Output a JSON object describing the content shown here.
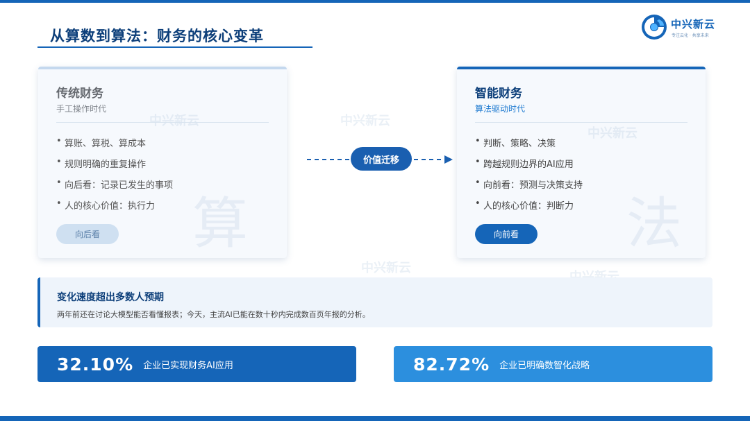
{
  "header": {
    "title": "从算数到算法：财务的核心变革",
    "logo_name": "中兴新云",
    "logo_slogan": "专注云化 · 共享未来",
    "logo_color": "#1565b8"
  },
  "traditional": {
    "title": "传统财务",
    "subtitle": "手工操作时代",
    "items": [
      "算账、算税、算成本",
      "规则明确的重复操作",
      "向后看：记录已发生的事项",
      "人的核心价值：执行力"
    ],
    "button": "向后看",
    "watermark": "算"
  },
  "transition": {
    "label": "价值迁移"
  },
  "intelligent": {
    "title": "智能财务",
    "subtitle": "算法驱动时代",
    "items": [
      "判断、策略、决策",
      "跨越规则边界的AI应用",
      "向前看：预测与决策支持",
      "人的核心价值：判断力"
    ],
    "button": "向前看",
    "watermark": "法"
  },
  "note": {
    "title": "变化速度超出多数人预期",
    "text": "两年前还在讨论大模型能否看懂报表；今天，主流AI已能在数十秒内完成数百页年报的分析。"
  },
  "stats": [
    {
      "value": "32.10%",
      "label": "企业已实现财务AI应用",
      "color": "#1565b8"
    },
    {
      "value": "82.72%",
      "label": "企业已明确数智化战略",
      "color": "#2c8fde"
    }
  ],
  "bullet": "•",
  "icons": [
    "logo-cloud-icon",
    "dashed-arrow-icon"
  ]
}
